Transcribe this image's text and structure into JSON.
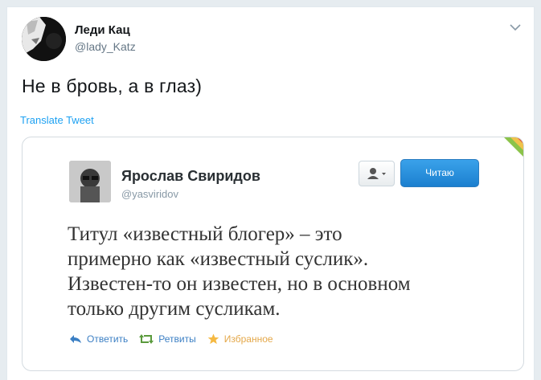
{
  "tweet": {
    "display_name": "Леди Кац",
    "handle": "@lady_Katz",
    "text": "Не в бровь, а в глаз)",
    "translate_label": "Translate Tweet",
    "caret_icon": "chevron-down-icon"
  },
  "quoted_image": {
    "display_name": "Ярослав Свиридов",
    "handle": "@yasviridov",
    "follow_label": "Читаю",
    "quote_lines": [
      "Титул «известный блогер» – это",
      "примерно как «известный суслик».",
      "Известен-то он известен, но в основном",
      "только другим сусликам."
    ],
    "actions": {
      "reply_label": "Ответить",
      "retweet_label": "Ретвиты",
      "favorite_label": "Избранное"
    },
    "colors": {
      "link": "#3b7fc4",
      "follow_button": "#1b7fcf",
      "favorite": "#e4a84a"
    }
  }
}
